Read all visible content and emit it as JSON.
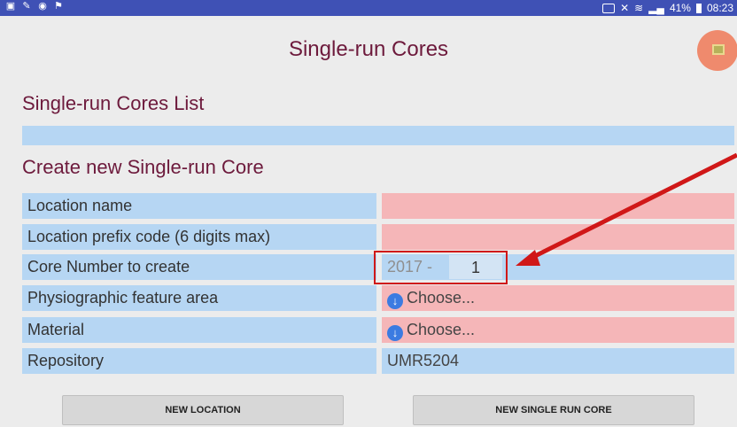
{
  "status_bar": {
    "time": "08:23",
    "battery": "41%"
  },
  "app": {
    "title": "Single-run Cores"
  },
  "sections": {
    "list_title": "Single-run Cores List",
    "create_title": "Create new Single-run Core"
  },
  "form": {
    "location_name_label": "Location name",
    "location_name_value": "",
    "prefix_label": "Location prefix code (6 digits max)",
    "prefix_value": "",
    "core_number_label": "Core Number to create",
    "core_year_prefix": "2017 -",
    "core_number_value": "1",
    "physio_label": "Physiographic feature area",
    "physio_value": "Choose...",
    "material_label": "Material",
    "material_value": "Choose...",
    "repository_label": "Repository",
    "repository_value": "UMR5204"
  },
  "buttons": {
    "new_location": "NEW LOCATION",
    "new_single_run_core": "NEW SINGLE RUN CORE"
  },
  "colors": {
    "accent": "#6d1a3c",
    "label_bg": "#b6d6f3",
    "required_bg": "#f5b6b8",
    "annotation": "#d01818"
  },
  "icons": {
    "dropdown": "arrow-down-circle-icon",
    "corner_action": "grid-tile-icon"
  }
}
